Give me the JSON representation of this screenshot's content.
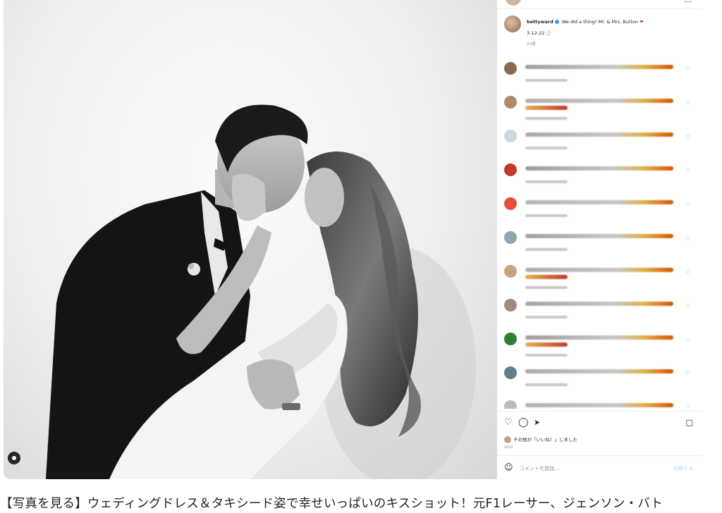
{
  "post": {
    "username": "bettyward",
    "caption": "We did a thing! Mr. & Mrs. Button",
    "caption_emoji": "❤",
    "date_text": "3-12-22 💍",
    "caption_time": "22週",
    "likes_text": "その他が「いいね！」しました",
    "post_date": "2022",
    "comment_placeholder": "コメントを追加...",
    "post_button": "投稿する"
  },
  "icons": {
    "like": "heart-outline",
    "comment": "speech-bubble",
    "share": "paper-plane",
    "save": "bookmark",
    "emoji": "smiley",
    "tag": "person-tag",
    "more": "ellipsis"
  },
  "colors": {
    "verified": "#3897f0",
    "text": "#262626",
    "muted": "#8e8e8e",
    "border": "#efefef"
  },
  "article": {
    "caption": "【写真を見る】ウェディングドレス＆タキシード姿で幸せいっぱいのキスショット！元F1レーサー、ジェンソン・バト"
  }
}
